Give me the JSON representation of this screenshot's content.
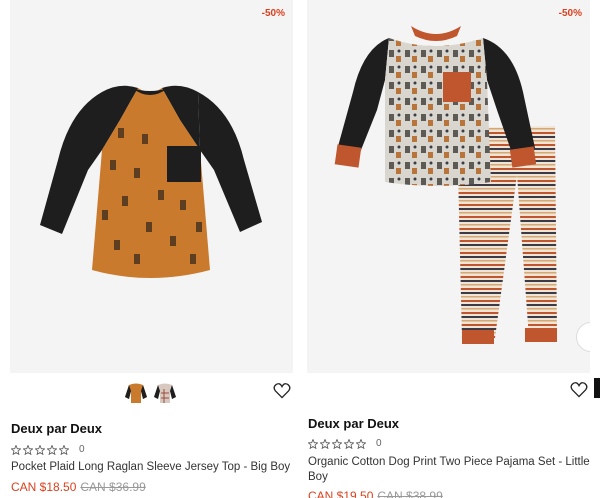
{
  "products": [
    {
      "discount": "-50%",
      "brand": "Deux par Deux",
      "rating_count": "0",
      "title": "Pocket Plaid Long Raglan Sleeve Jersey Top - Big Boy",
      "sale_price": "CAN $18.50",
      "original_price": "CAN $36.99",
      "swatches": [
        "orange-black-swatch",
        "plaid-swatch"
      ]
    },
    {
      "discount": "-50%",
      "brand": "Deux par Deux",
      "rating_count": "0",
      "title_line1": "Organic Cotton Dog Print Two Piece Pajama Set - Little",
      "title_line2": "Boy",
      "sale_price": "CAN $19.50",
      "original_price": "CAN $38.99"
    }
  ],
  "colors": {
    "sale": "#d9411e",
    "image_bg": "#f4f4f4",
    "shirt_orange": "#c97a2c",
    "sleeve_black": "#1e1e1e"
  }
}
